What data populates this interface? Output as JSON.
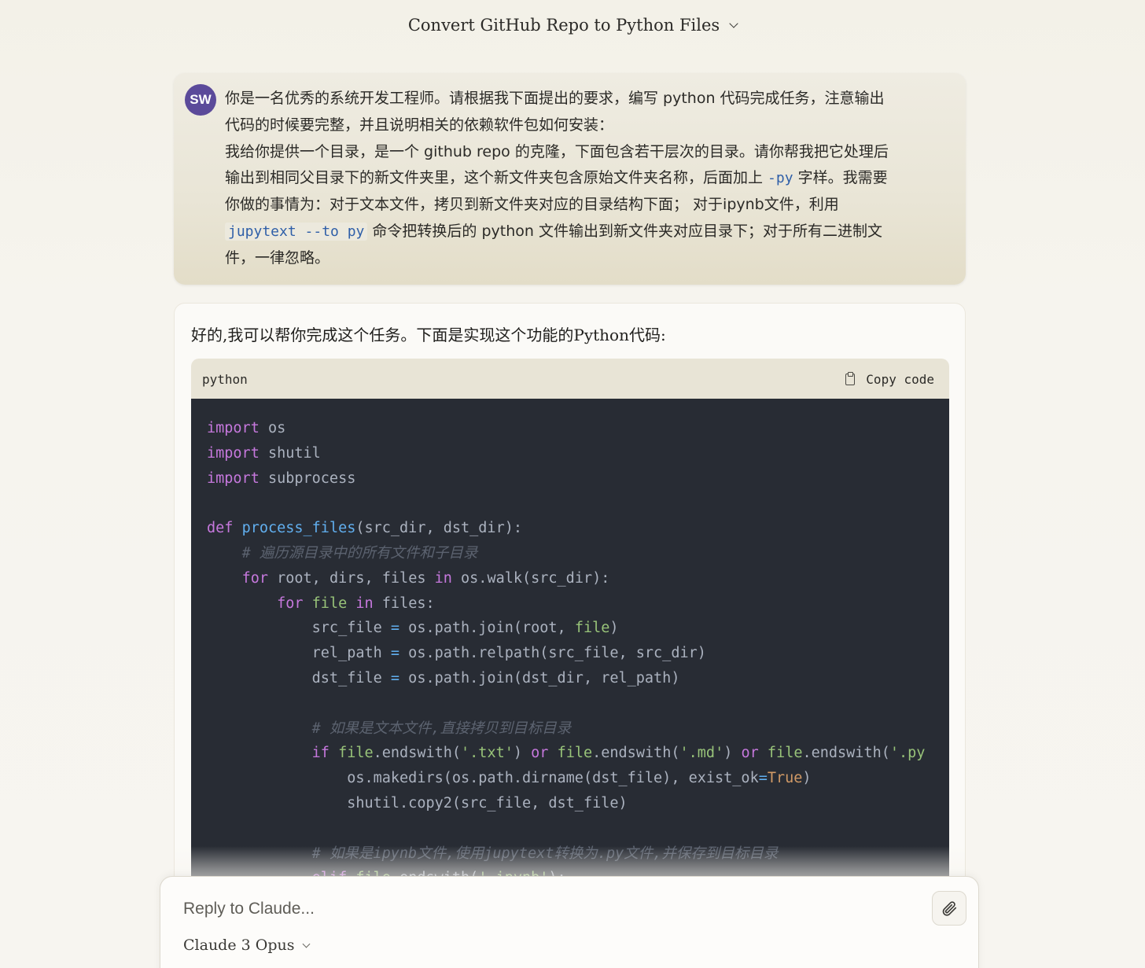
{
  "header": {
    "title": "Convert GitHub Repo to Python Files"
  },
  "user_message": {
    "avatar_initials": "SW",
    "text_1": "你是一名优秀的系统开发工程师。请根据我下面提出的要求，编写 python 代码完成任务，注意输出",
    "text_2": "代码的时候要完整，并且说明相关的依赖软件包如何安装：",
    "text_3": "我给你提供一个目录，是一个 github repo 的克隆，下面包含若干层次的目录。请你帮我把它处理后",
    "text_4a": "输出到相同父目录下的新文件夹里，这个新文件夹包含原始文件夹名称，后面加上 ",
    "text_4_code": "-py",
    "text_4b": " 字样。我需要",
    "text_5": "你做的事情为：对于文本文件，拷贝到新文件夹对应的目录结构下面； 对于ipynb文件，利用",
    "text_6_code": "jupytext --to py",
    "text_6b": " 命令把转换后的 python 文件输出到新文件夹对应目录下；对于所有二进制文",
    "text_7": "件，一律忽略。"
  },
  "assistant": {
    "intro": "好的,我可以帮你完成这个任务。下面是实现这个功能的Python代码:",
    "code_language": "python",
    "copy_label": "Copy code",
    "code": {
      "import_kw": "import",
      "mod_os": " os",
      "mod_shutil": " shutil",
      "mod_subprocess": " subprocess",
      "def_kw": "def",
      "fn_name": "process_files",
      "params": "(src_dir, dst_dir):",
      "comment_1": "# 遍历源目录中的所有文件和子目录",
      "for_kw": "for",
      "in_kw": "in",
      "loop1_vars": " root, dirs, files ",
      "loop1_iter": " os.walk(src_dir):",
      "loop2_var": "file",
      "loop2_iter": " files:",
      "src_file_lhs": "src_file ",
      "eq": "=",
      "src_file_rhs": " os.path.join(root, ",
      "close_paren": ")",
      "rel_path_lhs": "rel_path ",
      "rel_path_rhs": " os.path.relpath(src_file, src_dir)",
      "dst_file_lhs": "dst_file ",
      "dst_file_rhs": " os.path.join(dst_dir, rel_path)",
      "comment_2": "# 如果是文本文件,直接拷贝到目标目录",
      "if_kw": "if",
      "or_kw": "or",
      "endswith_open": ".endswith(",
      "str_txt": "'.txt'",
      "str_md": "'.md'",
      "str_py": "'.py",
      "makedirs_a": "os.makedirs(os.path.dirname(dst_file), exist_ok",
      "true_kw": "True",
      "copy_line": "shutil.copy2(src_file, dst_file)",
      "comment_3": "# 如果是ipynb文件,使用jupytext转换为.py文件,并保存到目标目录",
      "elif_kw": "elif",
      "str_ipynb": "'.ipynb'",
      "elif_tail": "):"
    }
  },
  "reply": {
    "placeholder": "Reply to Claude...",
    "model": "Claude 3 Opus"
  }
}
